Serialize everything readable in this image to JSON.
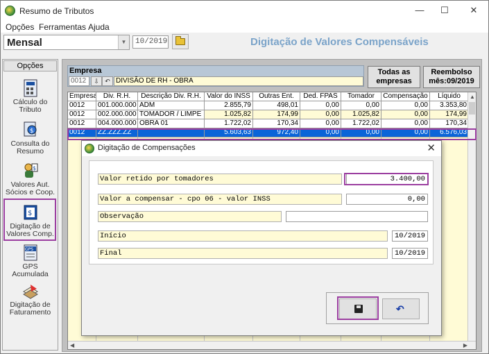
{
  "window": {
    "title": "Resumo de Tributos"
  },
  "menu": {
    "items": [
      "Opções",
      "Ferramentas",
      "Ajuda"
    ]
  },
  "toolbar": {
    "period_type": "Mensal",
    "month": "10/2019",
    "title": "Digitação de Valores Compensáveis"
  },
  "sidebar": {
    "header": "Opções",
    "items": [
      {
        "label": "Cálculo do Tributo",
        "icon": "calculator-icon"
      },
      {
        "label": "Consulta do Resumo",
        "icon": "query-icon"
      },
      {
        "label": "Valores Aut. Sócios e Coop.",
        "icon": "partners-icon"
      },
      {
        "label": "Digitação de Valores Comp.",
        "icon": "compensation-icon"
      },
      {
        "label": "GPS Acumulada",
        "icon": "gps-icon"
      },
      {
        "label": "Digitação de Faturamento",
        "icon": "billing-icon"
      }
    ]
  },
  "empresa": {
    "title": "Empresa",
    "code": "0012",
    "name": "DIVISÃO DE RH - OBRA"
  },
  "buttons": {
    "todas_empresas": "Todas as empresas",
    "reembolso": "Reembolso mês:09/2019"
  },
  "table": {
    "headers": [
      "Empresa",
      "Div. R.H.",
      "Descrição Div. R.H.",
      "Valor do INSS",
      "Outras Ent.",
      "Ded. FPAS",
      "Tomador",
      "Compensação",
      "Líquido"
    ],
    "rows": [
      [
        "0012",
        "001.000.000",
        "ADM",
        "2.855,79",
        "498,01",
        "0,00",
        "0,00",
        "0,00",
        "3.353,80"
      ],
      [
        "0012",
        "002.000.000",
        "TOMADOR / LIMPE",
        "1.025,82",
        "174,99",
        "0,00",
        "1.025,82",
        "0,00",
        "174,99"
      ],
      [
        "0012",
        "004.000.000",
        "OBRA 01",
        "1.722,02",
        "170,34",
        "0,00",
        "1.722,02",
        "0,00",
        "170,34"
      ],
      [
        "0012",
        "ZZ.ZZZ.ZZ",
        "",
        "5.603,63",
        "972,40",
        "0,00",
        "0,00",
        "0,00",
        "6.576,03"
      ]
    ]
  },
  "dialog": {
    "title": "Digitação de Compensações",
    "fields": {
      "valor_retido_label": "Valor retido por tomadores",
      "valor_retido": "3.400,00",
      "valor_compensar_label": "Valor a compensar - cpo 06 - valor INSS",
      "valor_compensar": "0,00",
      "observacao_label": "Observação",
      "observacao": "",
      "inicio_label": "Início",
      "inicio": "10/2019",
      "final_label": "Final",
      "final": "10/2019"
    }
  },
  "colors": {
    "selection": "#0a64d8",
    "highlight": "#9b3ea0",
    "field_bg": "#fffbd6",
    "title_accent": "#7aa3c9"
  }
}
